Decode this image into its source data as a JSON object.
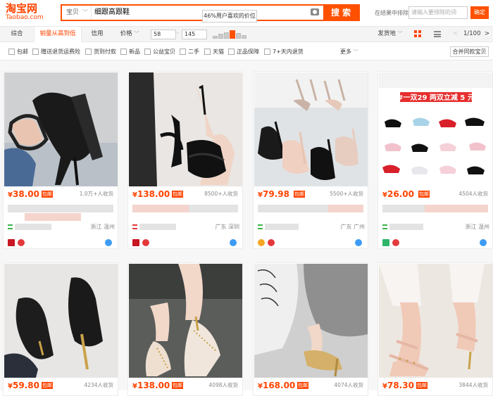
{
  "header": {
    "logo_cn": "淘宝网",
    "logo_en": "Taobao.com",
    "scope_label": "宝贝",
    "query": "细跟高跟鞋",
    "search_label": "搜索",
    "exclude_label": "在结果中排除",
    "exclude_placeholder": "请输入要排除的词",
    "exclude_button": "确定"
  },
  "tooltip": "46%用户喜欢的价位",
  "sortbar": {
    "sorts": [
      "综合",
      "销量从高到低",
      "信用",
      "价格"
    ],
    "price_min": "58",
    "price_max": "145",
    "dash": "-",
    "ship_from": "发货地",
    "pager": "1/100",
    "prev": "<",
    "next": ">"
  },
  "filters": {
    "items": [
      "包邮",
      "赠送退货运费险",
      "货到付款",
      "新品",
      "公益宝贝",
      "二手",
      "天猫",
      "正品保障",
      "7+天内退货"
    ],
    "more": "更多",
    "merge": "合并同款宝贝"
  },
  "products": [
    {
      "price": "38.00",
      "sold": "1.0万+人收货",
      "location": "浙江 温州",
      "tag": "包邮"
    },
    {
      "price": "138.00",
      "sold": "8500+人收货",
      "location": "广东 深圳",
      "tag": "包邮"
    },
    {
      "price": "79.98",
      "sold": "5500+人收货",
      "location": "广东 广州",
      "tag": "包邮"
    },
    {
      "price": "26.00",
      "sold": "4504人收货",
      "location": "浙江 温州",
      "tag": "包邮"
    },
    {
      "price": "59.80",
      "sold": "4234人收货",
      "location": "",
      "tag": "包邮"
    },
    {
      "price": "138.00",
      "sold": "4098人收货",
      "location": "",
      "tag": "包邮"
    },
    {
      "price": "168.00",
      "sold": "4074人收货",
      "location": "",
      "tag": "包邮"
    },
    {
      "price": "78.30",
      "sold": "3844人收货",
      "location": "",
      "tag": "包邮"
    }
  ],
  "banner4": "#一双29 两双立减 5 元",
  "currency": "¥",
  "colors": {
    "accent": "#ff5000",
    "price": "#ff4400"
  }
}
